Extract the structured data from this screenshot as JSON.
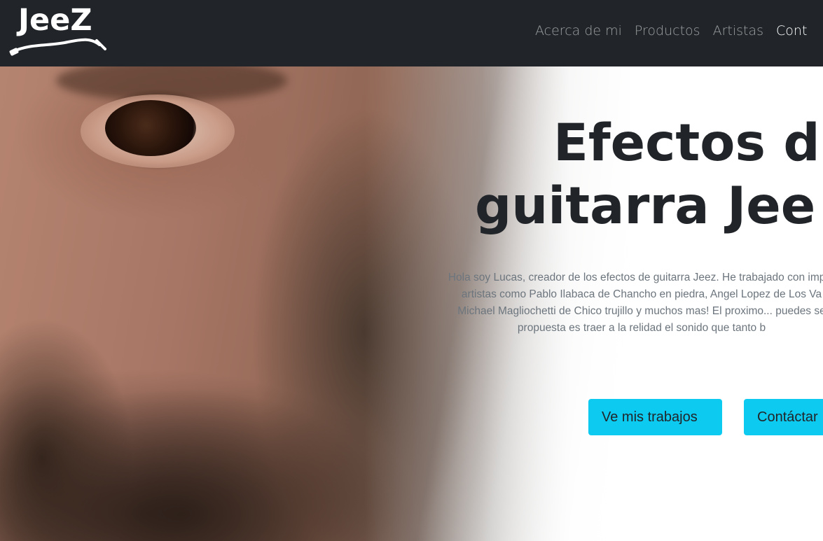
{
  "brand": {
    "logo_text": "JeeZ"
  },
  "nav": {
    "items": [
      {
        "label": "Acerca de mi",
        "active": false
      },
      {
        "label": "Productos",
        "active": false
      },
      {
        "label": "Artistas",
        "active": false
      },
      {
        "label": "Cont",
        "active": true
      }
    ]
  },
  "hero": {
    "title_line1": "Efectos d",
    "title_line2": "guitarra Jee",
    "text_lines": [
      "Hola soy Lucas, creador de los efectos de guitarra Jeez. He trabajado con impor",
      "artistas como Pablo Ilabaca de Chancho en piedra, Angel Lopez de Los Va",
      "Michael Magliochetti de Chico trujillo y muchos mas! El proximo... puedes se",
      "propuesta es traer a la relidad el sonido que tanto b"
    ],
    "primary_button": "Ve mis trabajos",
    "secondary_button": "Contáctar"
  },
  "colors": {
    "navbar_bg": "#212529",
    "button_bg": "#0dcaf0",
    "title_color": "#212529",
    "text_color": "#6c757d"
  }
}
